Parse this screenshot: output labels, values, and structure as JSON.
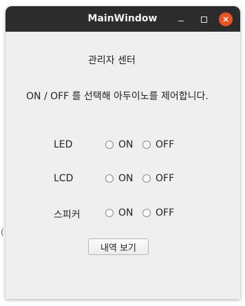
{
  "desktop": {
    "edge_fragment": "("
  },
  "window": {
    "title": "MainWindow",
    "controls": {
      "minimize_icon": "minimize-icon",
      "maximize_icon": "maximize-icon",
      "close_icon": "close-icon",
      "close_glyph": "×",
      "close_color": "#e95420"
    }
  },
  "content": {
    "heading": "관리자 센터",
    "instruction": "ON / OFF 를 선택해 아두이노를 제어합니다.",
    "rows": [
      {
        "label": "LED",
        "on": "ON",
        "off": "OFF"
      },
      {
        "label": "LCD",
        "on": "ON",
        "off": "OFF"
      },
      {
        "label": "스피커",
        "on": "ON",
        "off": "OFF"
      }
    ],
    "history_button": "내역 보기"
  },
  "colors": {
    "titlebar": "#2c2c2c",
    "window_bg": "#efefef",
    "accent": "#e95420"
  }
}
